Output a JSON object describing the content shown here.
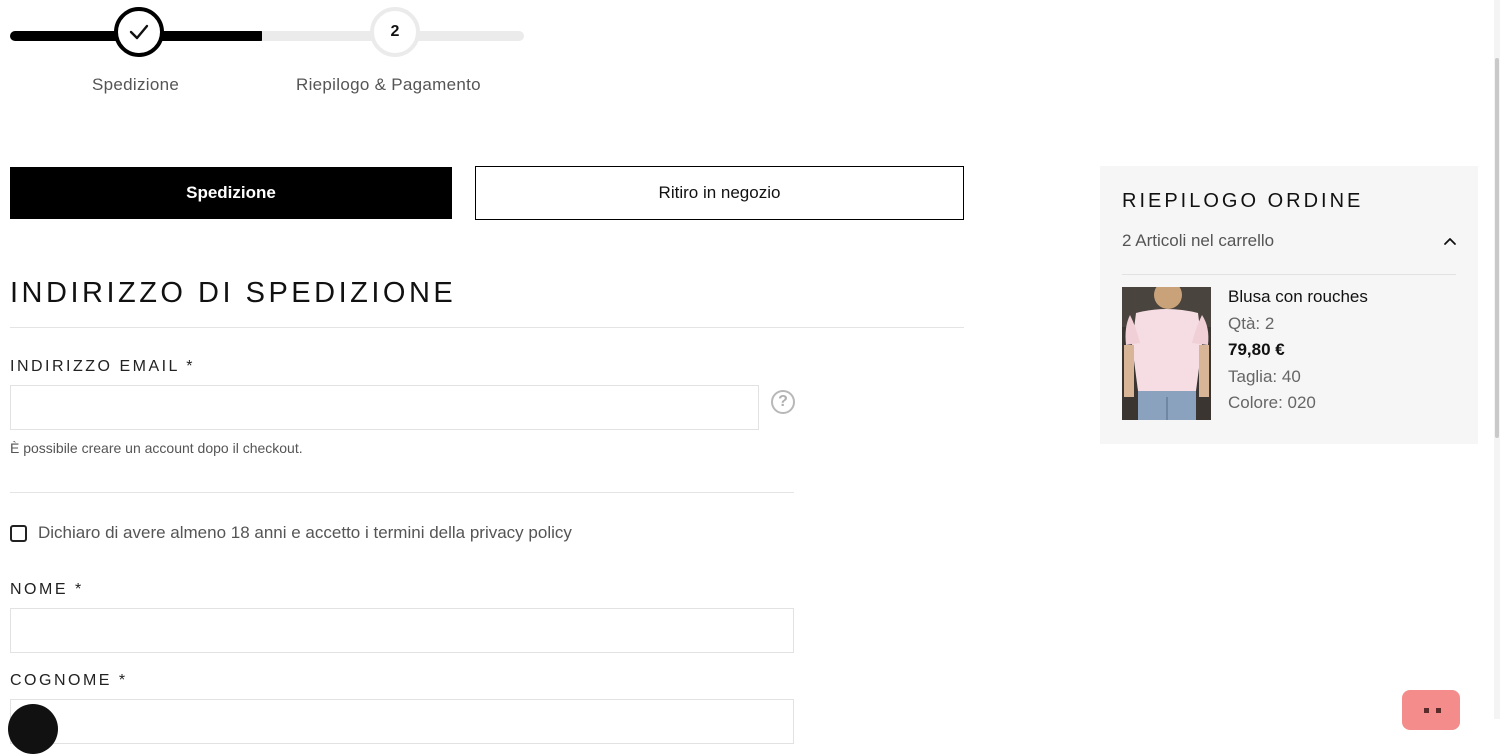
{
  "steps": [
    {
      "label": "Spedizione",
      "state": "done"
    },
    {
      "number": "2",
      "label": "Riepilogo & Pagamento",
      "state": "current"
    }
  ],
  "tabs": {
    "shipping": "Spedizione",
    "pickup": "Ritiro in negozio"
  },
  "section_title": "INDIRIZZO DI SPEDIZIONE",
  "email": {
    "label": "INDIRIZZO EMAIL *",
    "value": "",
    "hint": "È possibile creare un account dopo il checkout.",
    "help_icon": "?"
  },
  "privacy": {
    "label": "Dichiaro di avere almeno 18 anni e accetto i termini della privacy policy",
    "checked": false
  },
  "nome": {
    "label": "NOME *",
    "value": ""
  },
  "cognome": {
    "label": "COGNOME *",
    "value": ""
  },
  "summary": {
    "title": "RIEPILOGO ORDINE",
    "count_text": "2 Articoli nel carrello",
    "item": {
      "name": "Blusa con rouches",
      "qty": "Qtà: 2",
      "price": "79,80 €",
      "size": "Taglia:  40",
      "color": "Colore:  020"
    }
  },
  "colors": {
    "accent": "#000000",
    "track_inactive": "#ebebeb",
    "summary_bg": "#f6f6f6",
    "widget": "#f48c8c"
  }
}
